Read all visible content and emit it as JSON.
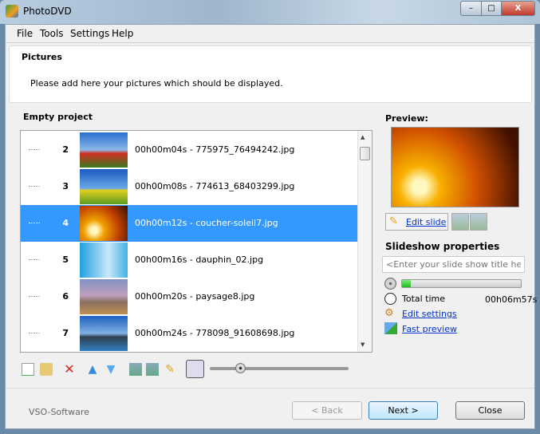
{
  "window": {
    "title": "PhotoDVD",
    "min": "–",
    "max": "□",
    "close": "X"
  },
  "menu": [
    "File",
    "Tools",
    "Settings",
    "Help"
  ],
  "header": {
    "title": "Pictures",
    "subtitle": "Please add here your pictures which should be displayed."
  },
  "project": {
    "label": "Empty project"
  },
  "rows": [
    {
      "num": "2",
      "text": "00h00m04s - 775975_76494242.jpg"
    },
    {
      "num": "3",
      "text": "00h00m08s - 774613_68403299.jpg"
    },
    {
      "num": "4",
      "text": "00h00m12s - coucher-soleil7.jpg",
      "selected": true
    },
    {
      "num": "5",
      "text": "00h00m16s - dauphin_02.jpg"
    },
    {
      "num": "6",
      "text": "00h00m20s - paysage8.jpg"
    },
    {
      "num": "7",
      "text": "00h00m24s - 778098_91608698.jpg"
    }
  ],
  "preview": {
    "label": "Preview:",
    "edit_slide": "Edit slide"
  },
  "slideshow": {
    "title": "Slideshow properties",
    "title_placeholder": "<Enter your slide show title here>",
    "progress_percent": 3,
    "total_time_label": "Total time",
    "total_time": "00h06m57s",
    "edit_settings": "Edit settings",
    "fast_preview": "Fast preview"
  },
  "footer": {
    "brand": "VSO-Software",
    "back": "< Back",
    "next": "Next >",
    "close": "Close"
  },
  "zoom_slider": 0.22
}
